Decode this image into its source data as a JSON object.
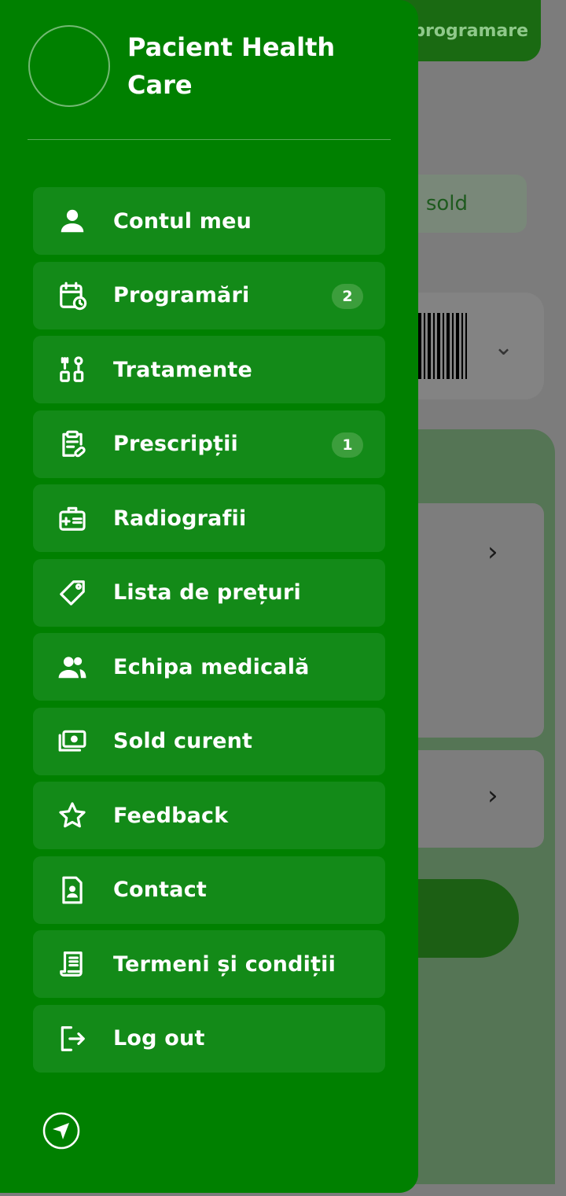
{
  "background": {
    "top_button_label": "programare",
    "sold_label": "sold"
  },
  "drawer": {
    "title": "Pacient Health Care",
    "items": [
      {
        "label": "Contul meu",
        "icon": "user-icon"
      },
      {
        "label": "Programări",
        "icon": "calendar-clock-icon",
        "badge": "2"
      },
      {
        "label": "Tratamente",
        "icon": "tooth-tools-icon"
      },
      {
        "label": "Prescripții",
        "icon": "clipboard-prescription-icon",
        "badge": "1"
      },
      {
        "label": "Radiografii",
        "icon": "medical-kit-icon"
      },
      {
        "label": "Lista de prețuri",
        "icon": "price-tag-icon"
      },
      {
        "label": "Echipa medicală",
        "icon": "team-icon"
      },
      {
        "label": "Sold curent",
        "icon": "money-icon"
      },
      {
        "label": "Feedback",
        "icon": "star-icon"
      },
      {
        "label": "Contact",
        "icon": "contact-card-icon"
      },
      {
        "label": "Termeni și condiții",
        "icon": "document-icon"
      },
      {
        "label": "Log out",
        "icon": "logout-icon"
      }
    ]
  },
  "colors": {
    "drawer_bg": "#008000",
    "item_bg": "#138a18",
    "badge_bg": "#3c9e3c"
  }
}
